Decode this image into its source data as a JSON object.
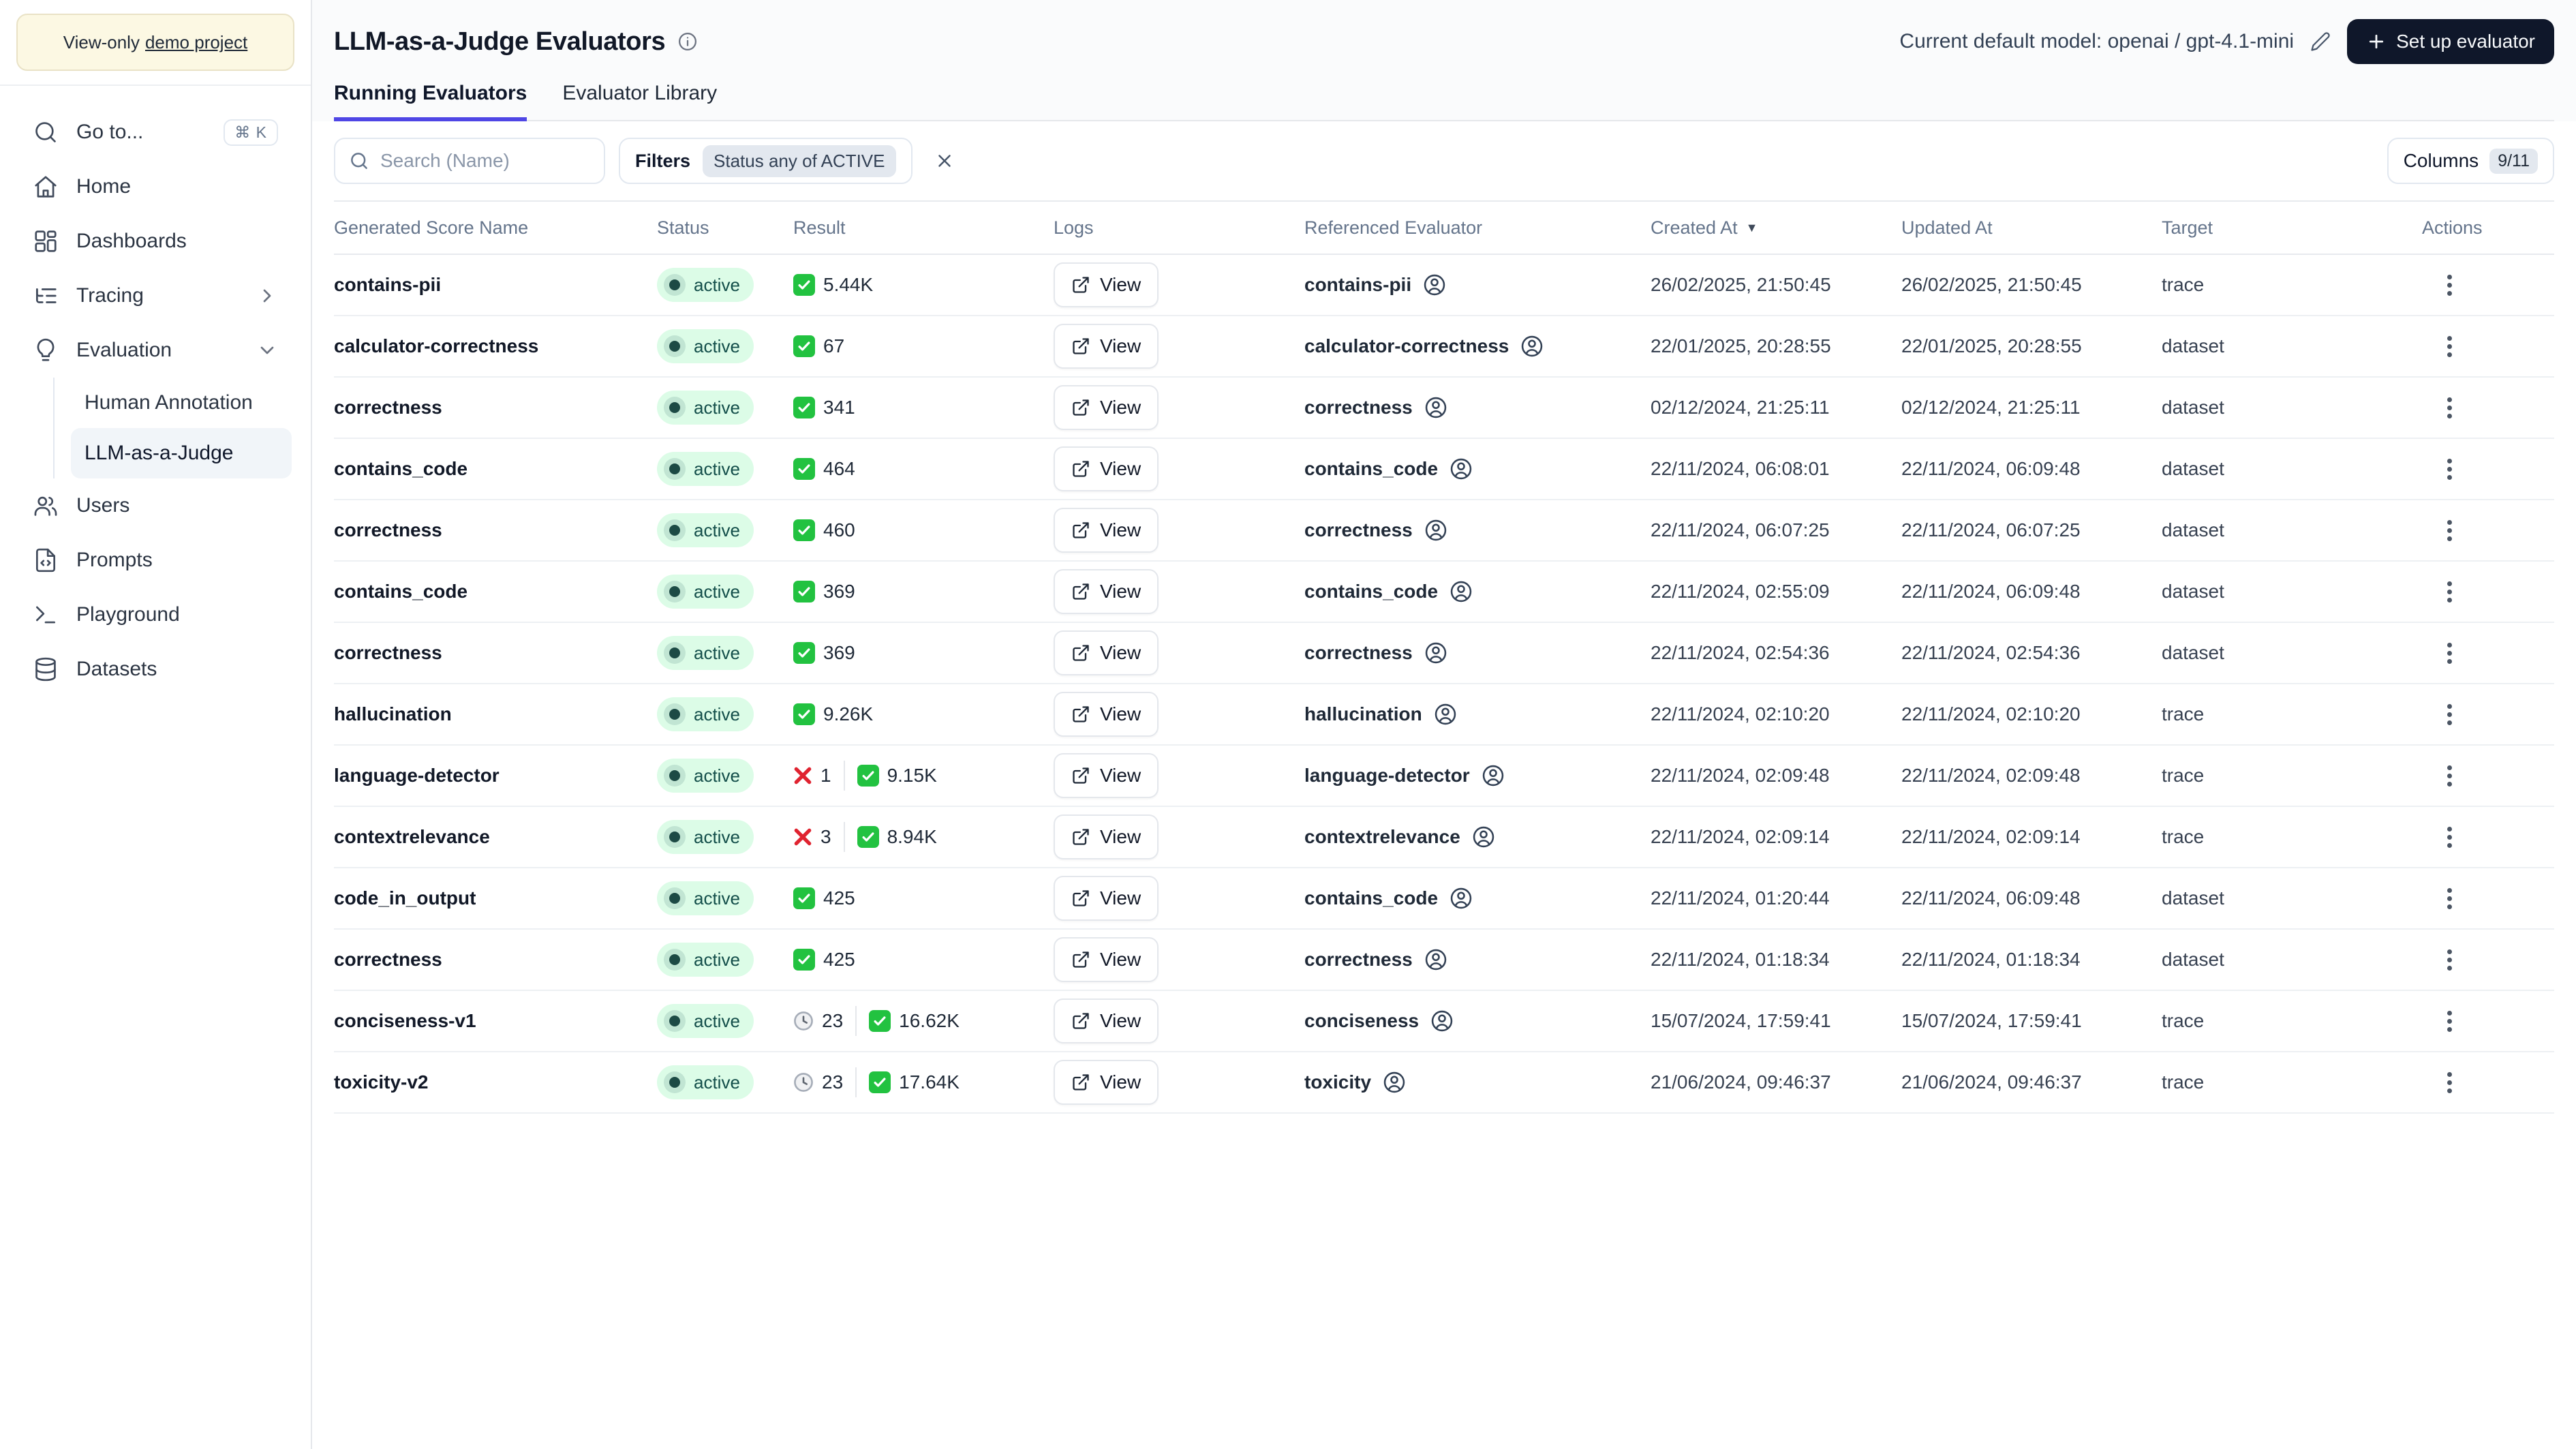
{
  "sidebar": {
    "banner": {
      "prefix": "View-only",
      "link": "demo project"
    },
    "items": [
      {
        "label": "Go to...",
        "icon": "search",
        "shortcut": "⌘ K"
      },
      {
        "label": "Home",
        "icon": "home"
      },
      {
        "label": "Dashboards",
        "icon": "grid"
      },
      {
        "label": "Tracing",
        "icon": "list-tree",
        "chevron": "right"
      },
      {
        "label": "Evaluation",
        "icon": "lightbulb",
        "chevron": "down"
      },
      {
        "label": "Users",
        "icon": "users"
      },
      {
        "label": "Prompts",
        "icon": "file-code"
      },
      {
        "label": "Playground",
        "icon": "terminal"
      },
      {
        "label": "Datasets",
        "icon": "database"
      }
    ],
    "evaluation_children": [
      {
        "label": "Human Annotation",
        "active": false
      },
      {
        "label": "LLM-as-a-Judge",
        "active": true
      }
    ]
  },
  "header": {
    "title": "LLM-as-a-Judge Evaluators",
    "model_label": "Current default model: openai / gpt-4.1-mini",
    "setup_button": "Set up evaluator"
  },
  "tabs": [
    {
      "label": "Running Evaluators",
      "active": true
    },
    {
      "label": "Evaluator Library",
      "active": false
    }
  ],
  "toolbar": {
    "search_placeholder": "Search (Name)",
    "filters_label": "Filters",
    "filter_chip": "Status any of ACTIVE",
    "columns_label": "Columns",
    "columns_badge": "9/11"
  },
  "table": {
    "columns": [
      "Generated Score Name",
      "Status",
      "Result",
      "Logs",
      "Referenced Evaluator",
      "Created At",
      "Updated At",
      "Target",
      "Actions"
    ],
    "sorted_column": "Created At",
    "sort_direction": "desc",
    "logs_button_label": "View",
    "rows": [
      {
        "name": "contains-pii",
        "status": "active",
        "result": {
          "pass": "5.44K"
        },
        "evaluator": "contains-pii",
        "created": "26/02/2025, 21:50:45",
        "updated": "26/02/2025, 21:50:45",
        "target": "trace"
      },
      {
        "name": "calculator-correctness",
        "status": "active",
        "result": {
          "pass": "67"
        },
        "evaluator": "calculator-correctness",
        "created": "22/01/2025, 20:28:55",
        "updated": "22/01/2025, 20:28:55",
        "target": "dataset"
      },
      {
        "name": "correctness",
        "status": "active",
        "result": {
          "pass": "341"
        },
        "evaluator": "correctness",
        "created": "02/12/2024, 21:25:11",
        "updated": "02/12/2024, 21:25:11",
        "target": "dataset"
      },
      {
        "name": "contains_code",
        "status": "active",
        "result": {
          "pass": "464"
        },
        "evaluator": "contains_code",
        "created": "22/11/2024, 06:08:01",
        "updated": "22/11/2024, 06:09:48",
        "target": "dataset"
      },
      {
        "name": "correctness",
        "status": "active",
        "result": {
          "pass": "460"
        },
        "evaluator": "correctness",
        "created": "22/11/2024, 06:07:25",
        "updated": "22/11/2024, 06:07:25",
        "target": "dataset"
      },
      {
        "name": "contains_code",
        "status": "active",
        "result": {
          "pass": "369"
        },
        "evaluator": "contains_code",
        "created": "22/11/2024, 02:55:09",
        "updated": "22/11/2024, 06:09:48",
        "target": "dataset"
      },
      {
        "name": "correctness",
        "status": "active",
        "result": {
          "pass": "369"
        },
        "evaluator": "correctness",
        "created": "22/11/2024, 02:54:36",
        "updated": "22/11/2024, 02:54:36",
        "target": "dataset"
      },
      {
        "name": "hallucination",
        "status": "active",
        "result": {
          "pass": "9.26K"
        },
        "evaluator": "hallucination",
        "created": "22/11/2024, 02:10:20",
        "updated": "22/11/2024, 02:10:20",
        "target": "trace"
      },
      {
        "name": "language-detector",
        "status": "active",
        "result": {
          "fail": "1",
          "pass": "9.15K"
        },
        "evaluator": "language-detector",
        "created": "22/11/2024, 02:09:48",
        "updated": "22/11/2024, 02:09:48",
        "target": "trace"
      },
      {
        "name": "contextrelevance",
        "status": "active",
        "result": {
          "fail": "3",
          "pass": "8.94K"
        },
        "evaluator": "contextrelevance",
        "created": "22/11/2024, 02:09:14",
        "updated": "22/11/2024, 02:09:14",
        "target": "trace"
      },
      {
        "name": "code_in_output",
        "status": "active",
        "result": {
          "pass": "425"
        },
        "evaluator": "contains_code",
        "created": "22/11/2024, 01:20:44",
        "updated": "22/11/2024, 06:09:48",
        "target": "dataset"
      },
      {
        "name": "correctness",
        "status": "active",
        "result": {
          "pass": "425"
        },
        "evaluator": "correctness",
        "created": "22/11/2024, 01:18:34",
        "updated": "22/11/2024, 01:18:34",
        "target": "dataset"
      },
      {
        "name": "conciseness-v1",
        "status": "active",
        "result": {
          "pending": "23",
          "pass": "16.62K"
        },
        "evaluator": "conciseness",
        "created": "15/07/2024, 17:59:41",
        "updated": "15/07/2024, 17:59:41",
        "target": "trace"
      },
      {
        "name": "toxicity-v2",
        "status": "active",
        "result": {
          "pending": "23",
          "pass": "17.64K"
        },
        "evaluator": "toxicity",
        "created": "21/06/2024, 09:46:37",
        "updated": "21/06/2024, 09:46:37",
        "target": "trace"
      }
    ]
  },
  "colors": {
    "accent": "#4f46e5",
    "active_pill_bg": "#dcfce7",
    "active_pill_text": "#134e4a",
    "dark_button": "#0f172a",
    "pass_green": "#22c240",
    "fail_red": "#e02330"
  }
}
